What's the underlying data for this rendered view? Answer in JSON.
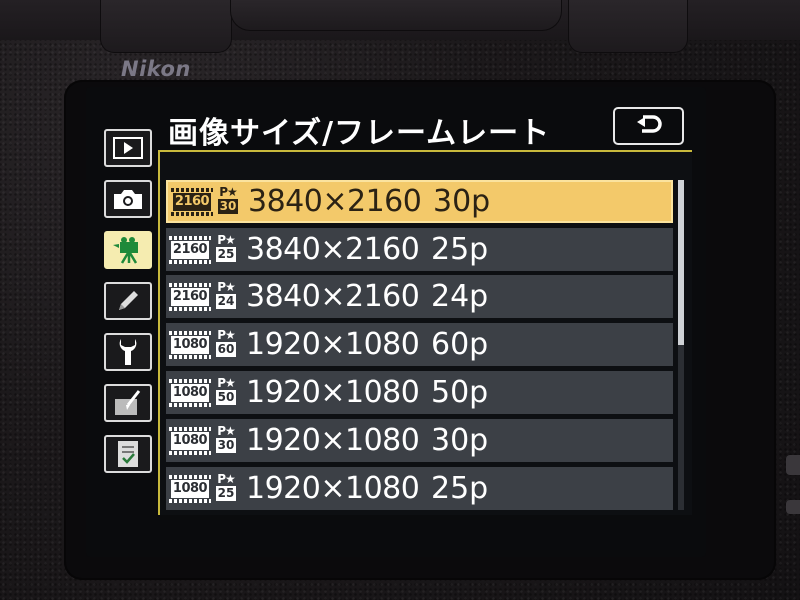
{
  "brand": "Nikon",
  "menu": {
    "title": "画像サイズ/フレームレート",
    "back_icon": "return-arrow-icon"
  },
  "sidebar": {
    "tabs": [
      {
        "name": "playback",
        "icon": "playback-icon",
        "active": false
      },
      {
        "name": "photo-shooting",
        "icon": "camera-icon",
        "active": false
      },
      {
        "name": "movie-shooting",
        "icon": "movie-camera-icon",
        "active": true
      },
      {
        "name": "custom-settings",
        "icon": "pencil-icon",
        "active": false
      },
      {
        "name": "setup",
        "icon": "wrench-icon",
        "active": false
      },
      {
        "name": "retouch",
        "icon": "retouch-brush-icon",
        "active": false
      },
      {
        "name": "my-menu",
        "icon": "my-menu-checklist-icon",
        "active": false
      }
    ]
  },
  "options": [
    {
      "size_badge": "2160",
      "rate_badge": "30",
      "resolution": "3840×2160",
      "rate": "30p",
      "selected": true
    },
    {
      "size_badge": "2160",
      "rate_badge": "25",
      "resolution": "3840×2160",
      "rate": "25p",
      "selected": false
    },
    {
      "size_badge": "2160",
      "rate_badge": "24",
      "resolution": "3840×2160",
      "rate": "24p",
      "selected": false
    },
    {
      "size_badge": "1080",
      "rate_badge": "60",
      "resolution": "1920×1080",
      "rate": "60p",
      "selected": false
    },
    {
      "size_badge": "1080",
      "rate_badge": "50",
      "resolution": "1920×1080",
      "rate": "50p",
      "selected": false
    },
    {
      "size_badge": "1080",
      "rate_badge": "30",
      "resolution": "1920×1080",
      "rate": "30p",
      "selected": false
    },
    {
      "size_badge": "1080",
      "rate_badge": "25",
      "resolution": "1920×1080",
      "rate": "25p",
      "selected": false
    }
  ],
  "badge_mark": "P★",
  "colors": {
    "highlight": "#f3c96a",
    "row_bg": "#3c4046",
    "accent_rule": "#c8b93c",
    "active_tab": "#f5ecb0"
  },
  "scroll": {
    "visible_fraction": 0.5,
    "position": 0
  }
}
